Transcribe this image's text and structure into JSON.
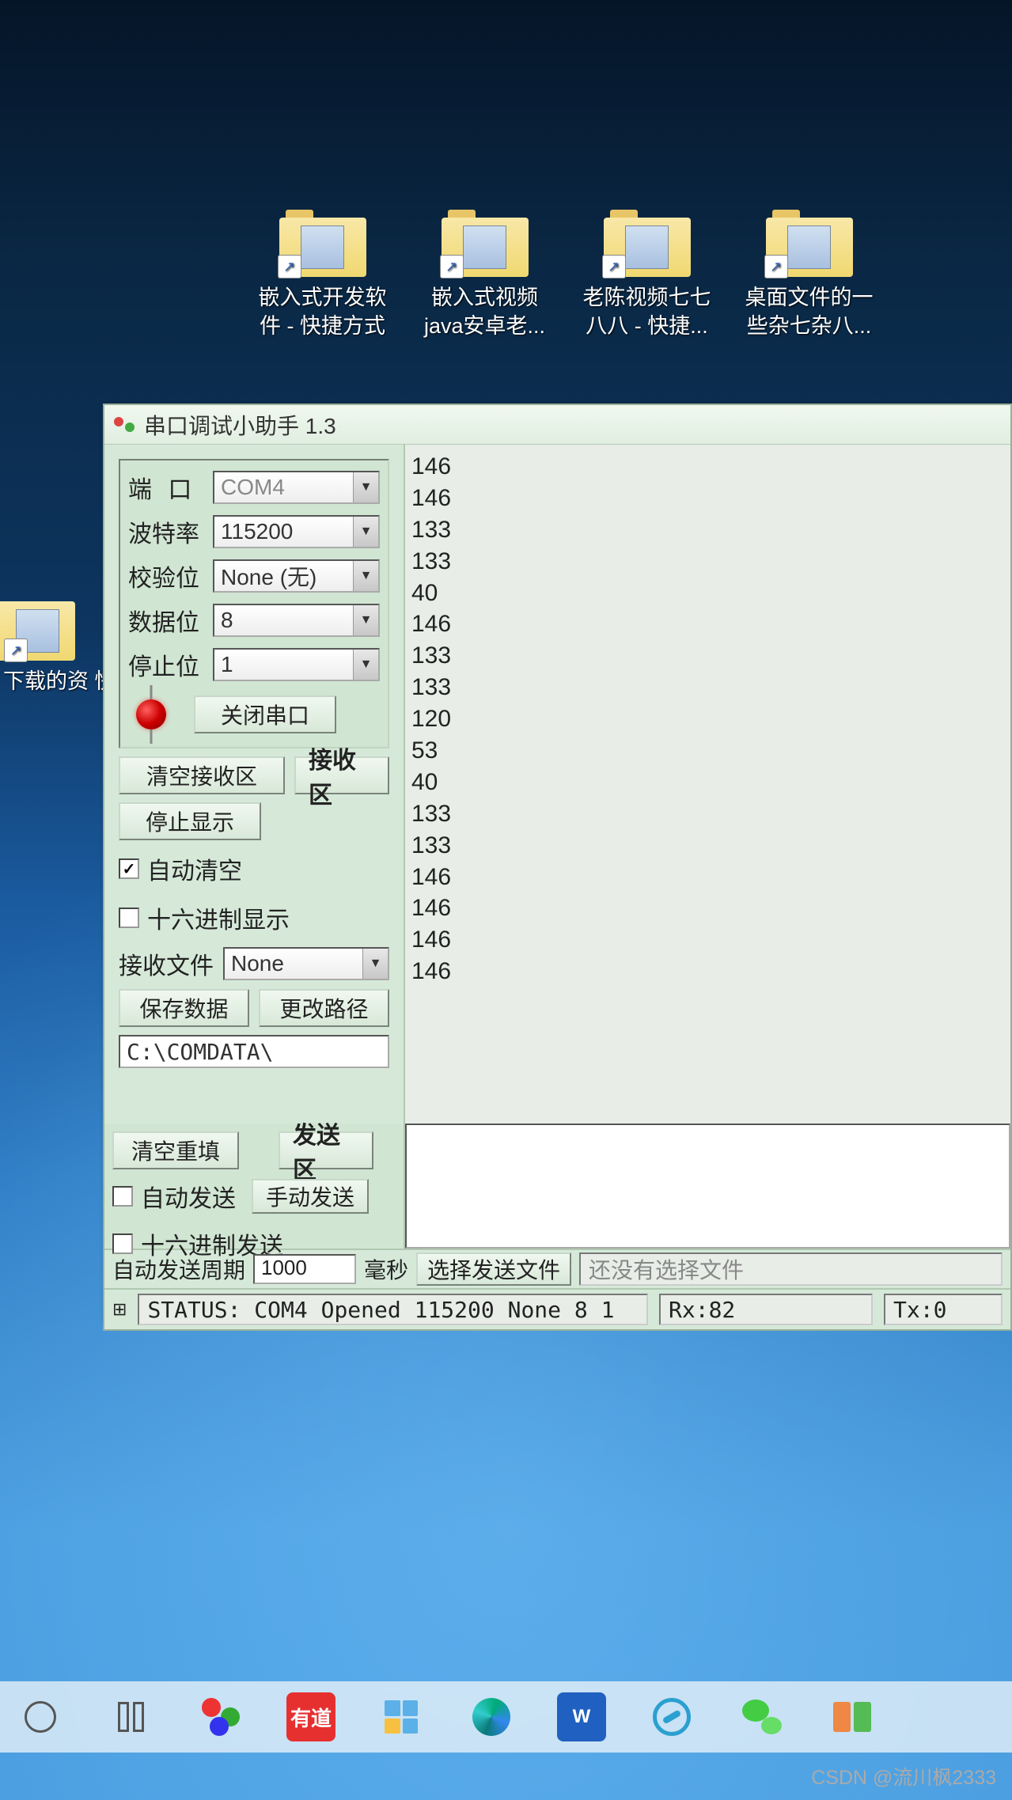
{
  "desktop": {
    "icons": [
      {
        "label": "嵌入式开发软\n件 - 快捷方式"
      },
      {
        "label": "嵌入式视频\njava安卓老..."
      },
      {
        "label": "老陈视频七七\n八八 - 快捷..."
      },
      {
        "label": "桌面文件的一\n些杂七杂八..."
      }
    ],
    "partial_icon": {
      "label": "下载的资\n快捷方式"
    }
  },
  "window": {
    "title": "串口调试小助手 1.3",
    "settings": {
      "port_label": "端 口",
      "port_value": "COM4",
      "baud_label": "波特率",
      "baud_value": "115200",
      "parity_label": "校验位",
      "parity_value": "None (无)",
      "databits_label": "数据位",
      "databits_value": "8",
      "stopbits_label": "停止位",
      "stopbits_value": "1",
      "close_port_btn": "关闭串口"
    },
    "receive_controls": {
      "clear_btn": "清空接收区",
      "area_label": "接收区",
      "stop_display_btn": "停止显示",
      "auto_clear_label": "自动清空",
      "auto_clear_checked": true,
      "hex_display_label": "十六进制显示",
      "hex_display_checked": false,
      "recv_file_label": "接收文件",
      "recv_file_value": "None",
      "save_data_btn": "保存数据",
      "change_path_btn": "更改路径",
      "path_value": "C:\\COMDATA\\"
    },
    "received_data": [
      "146",
      "146",
      "133",
      "133",
      "40",
      "146",
      "133",
      "133",
      "120",
      "53",
      "40",
      "133",
      "133",
      "146",
      "146",
      "146",
      "146"
    ],
    "send_controls": {
      "clear_send_btn": "清空重填",
      "send_area_label": "发送区",
      "auto_send_label": "自动发送",
      "auto_send_checked": false,
      "manual_send_btn": "手动发送",
      "hex_send_label": "十六进制发送",
      "hex_send_checked": false,
      "period_label": "自动发送周期",
      "period_value": "1000",
      "period_unit": "毫秒",
      "select_file_btn": "选择发送文件",
      "no_file_text": "还没有选择文件"
    },
    "status_bar": {
      "status_text": "STATUS:  COM4 Opened 115200 None  8 1",
      "rx_text": "Rx:82",
      "tx_text": "Tx:0"
    }
  },
  "taskbar_items": [
    "cortana",
    "taskview",
    "baidu",
    "youdao",
    "filemanager",
    "edge",
    "wps",
    "tool",
    "wechat",
    "multidesk"
  ],
  "watermark": "CSDN @流川枫2333"
}
